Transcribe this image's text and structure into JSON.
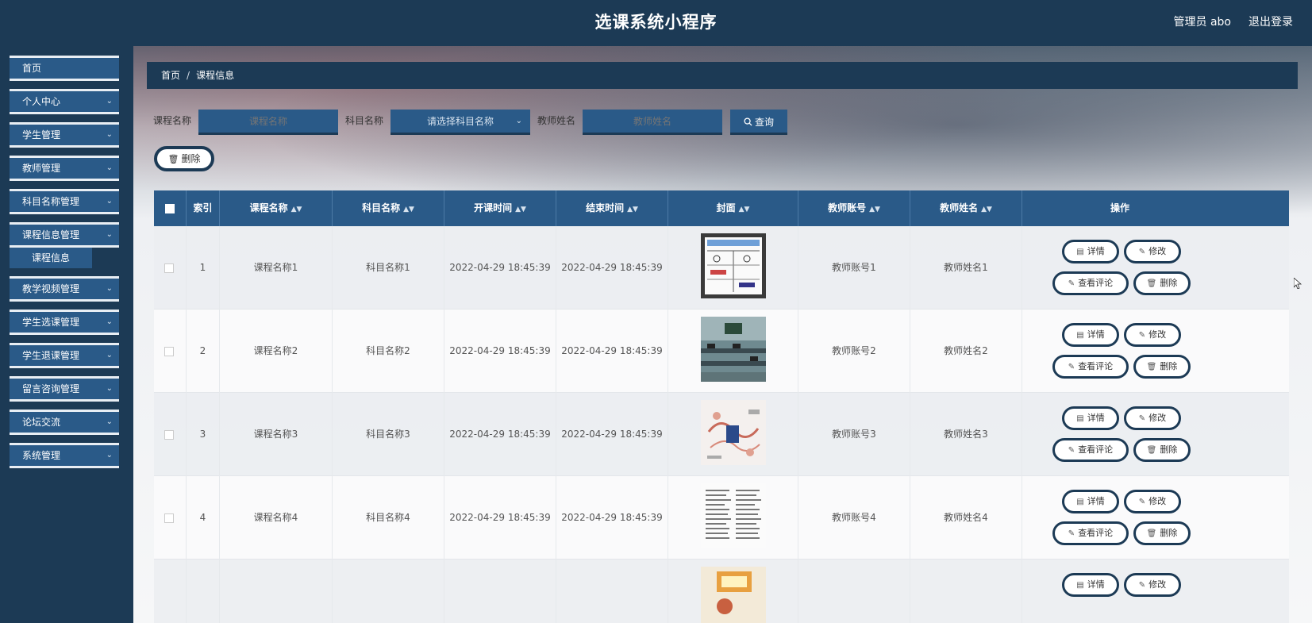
{
  "header": {
    "title": "选课系统小程序",
    "user": "管理员 abo",
    "logout": "退出登录"
  },
  "sidebar": {
    "items": [
      {
        "label": "首页",
        "expandable": false
      },
      {
        "label": "个人中心",
        "expandable": true
      },
      {
        "label": "学生管理",
        "expandable": true
      },
      {
        "label": "教师管理",
        "expandable": true
      },
      {
        "label": "科目名称管理",
        "expandable": true
      },
      {
        "label": "课程信息管理",
        "expandable": true
      },
      {
        "label": "教学视频管理",
        "expandable": true
      },
      {
        "label": "学生选课管理",
        "expandable": true
      },
      {
        "label": "学生退课管理",
        "expandable": true
      },
      {
        "label": "留言咨询管理",
        "expandable": true
      },
      {
        "label": "论坛交流",
        "expandable": true
      },
      {
        "label": "系统管理",
        "expandable": true
      }
    ],
    "sub_item": "课程信息"
  },
  "breadcrumb": {
    "home": "首页",
    "separator": "/",
    "current": "课程信息"
  },
  "search": {
    "course_label": "课程名称",
    "course_placeholder": "课程名称",
    "subject_label": "科目名称",
    "subject_placeholder": "请选择科目名称",
    "teacher_label": "教师姓名",
    "teacher_placeholder": "教师姓名",
    "query_button": "查询"
  },
  "batch_delete": "删除",
  "table": {
    "columns": [
      "索引",
      "课程名称",
      "科目名称",
      "开课时间",
      "结束时间",
      "封面",
      "教师账号",
      "教师姓名",
      "操作"
    ],
    "rows": [
      {
        "index": "1",
        "course": "课程名称1",
        "subject": "科目名称1",
        "start": "2022-04-29 18:45:39",
        "end": "2022-04-29 18:45:39",
        "teacher_account": "教师账号1",
        "teacher_name": "教师姓名1"
      },
      {
        "index": "2",
        "course": "课程名称2",
        "subject": "科目名称2",
        "start": "2022-04-29 18:45:39",
        "end": "2022-04-29 18:45:39",
        "teacher_account": "教师账号2",
        "teacher_name": "教师姓名2"
      },
      {
        "index": "3",
        "course": "课程名称3",
        "subject": "科目名称3",
        "start": "2022-04-29 18:45:39",
        "end": "2022-04-29 18:45:39",
        "teacher_account": "教师账号3",
        "teacher_name": "教师姓名3"
      },
      {
        "index": "4",
        "course": "课程名称4",
        "subject": "科目名称4",
        "start": "2022-04-29 18:45:39",
        "end": "2022-04-29 18:45:39",
        "teacher_account": "教师账号4",
        "teacher_name": "教师姓名4"
      }
    ],
    "actions": {
      "detail": "详情",
      "edit": "修改",
      "comments": "查看评论",
      "delete": "删除"
    }
  },
  "colors": {
    "primary": "#1c3a55",
    "accent": "#2a5a88"
  }
}
